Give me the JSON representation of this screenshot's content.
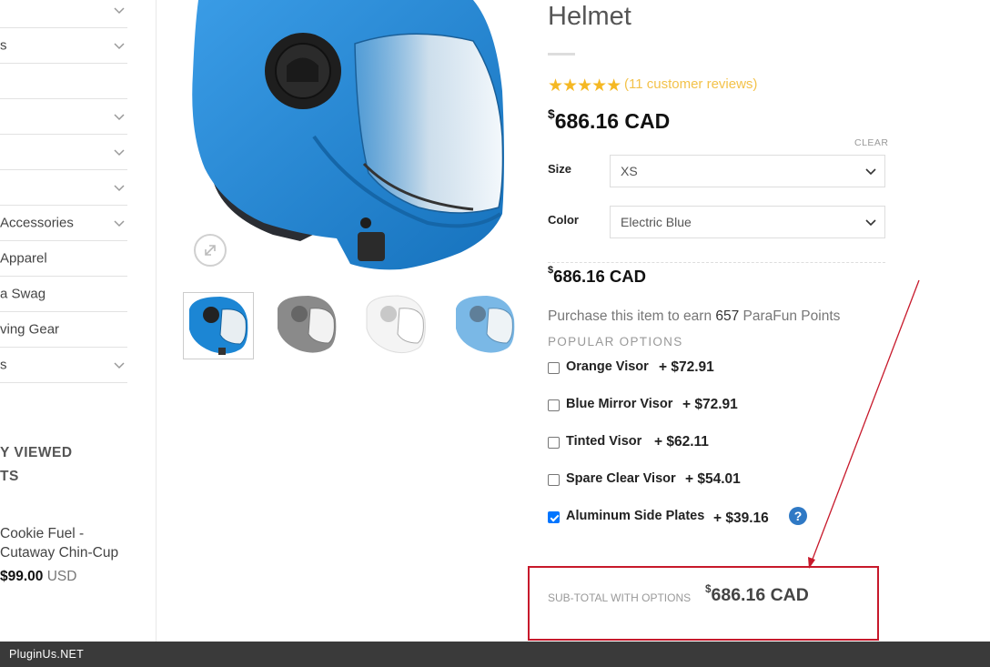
{
  "sidebar": {
    "categories": [
      {
        "label": "",
        "has_chevron": true
      },
      {
        "label": "s",
        "has_chevron": true
      },
      {
        "label": "",
        "has_chevron": false
      },
      {
        "label": "",
        "has_chevron": true
      },
      {
        "label": "",
        "has_chevron": true
      },
      {
        "label": "",
        "has_chevron": true
      },
      {
        "label": "Accessories",
        "has_chevron": true
      },
      {
        "label": "Apparel",
        "has_chevron": false
      },
      {
        "label": "a Swag",
        "has_chevron": false
      },
      {
        "label": "ving Gear",
        "has_chevron": false
      },
      {
        "label": "s",
        "has_chevron": true
      }
    ],
    "recently_viewed": {
      "title_line1": "Y VIEWED",
      "title_line2": "TS",
      "product_name_line1": "Cookie Fuel -",
      "product_name_line2": "Cutaway Chin-Cup",
      "price": "$99.00",
      "currency": "USD"
    }
  },
  "gallery": {
    "zoom_icon": "expand-icon",
    "thumbnails": [
      "Electric Blue",
      "Grey",
      "White",
      "Light Blue"
    ]
  },
  "product": {
    "title": "Helmet",
    "rating_stars": "★★★★★",
    "rating": 5,
    "reviews_text": "(11 customer reviews)",
    "price_symbol": "$",
    "price": "686.16 CAD",
    "clear_label": "CLEAR",
    "size_label": "Size",
    "size_value": "XS",
    "color_label": "Color",
    "color_value": "Electric Blue",
    "variation_price_symbol": "$",
    "variation_price": "686.16 CAD",
    "points_text_before": "Purchase this item to earn ",
    "points_value": "657",
    "points_text_after": " ParaFun Points",
    "popular_options_label": "POPULAR OPTIONS",
    "options": [
      {
        "name": "Orange Visor",
        "price": "+ $72.91",
        "checked": false
      },
      {
        "name": "Blue Mirror Visor",
        "price": "+ $72.91",
        "checked": false
      },
      {
        "name": "Tinted Visor",
        "price": "+ $62.11",
        "checked": false
      },
      {
        "name": "Spare Clear Visor",
        "price": "+ $54.01",
        "checked": false
      },
      {
        "name": "Aluminum Side Plates",
        "price": "+ $39.16",
        "checked": true
      }
    ],
    "help_glyph": "?",
    "subtotal_label": "SUB-TOTAL WITH OPTIONS",
    "subtotal_symbol": "$",
    "subtotal_price": "686.16 CAD"
  },
  "footer": {
    "brand": "PluginUs.NET"
  },
  "colors": {
    "helmet_blue": "#1c86d4",
    "star_gold": "#f5b823",
    "checkbox_blue": "#0075ff",
    "annotation_red": "#c7192b"
  }
}
